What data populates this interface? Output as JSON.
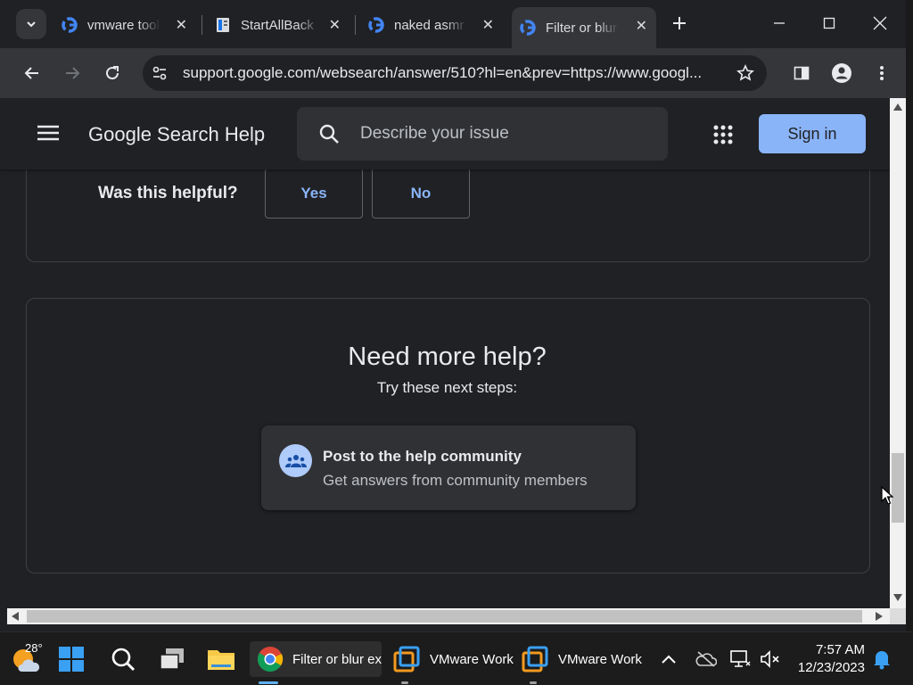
{
  "browser": {
    "tabs": [
      {
        "title": "vmware tool",
        "icon": "google-g-icon",
        "active": false
      },
      {
        "title": "StartAllBack",
        "icon": "startallback-icon",
        "active": false
      },
      {
        "title": "naked asmr",
        "icon": "google-g-icon",
        "active": false
      },
      {
        "title": "Filter or blur",
        "icon": "google-g-icon",
        "active": true
      }
    ],
    "url": "support.google.com/websearch/answer/510?hl=en&prev=https://www.googl..."
  },
  "header": {
    "brand": "Google Search Help",
    "search_placeholder": "Describe your issue",
    "signin_label": "Sign in"
  },
  "feedback": {
    "question": "Was this helpful?",
    "yes_label": "Yes",
    "no_label": "No"
  },
  "more_help": {
    "title": "Need more help?",
    "subtitle": "Try these next steps:",
    "community_title": "Post to the help community",
    "community_desc": "Get answers from community members"
  },
  "taskbar": {
    "weather_temp": "28°",
    "apps": [
      {
        "label": "Filter or blur ex",
        "icon": "chrome-icon"
      },
      {
        "label": "VMware Work",
        "icon": "vmware-icon"
      },
      {
        "label": "VMware Work",
        "icon": "vmware-icon"
      }
    ],
    "time": "7:57 AM",
    "date": "12/23/2023"
  },
  "colors": {
    "accent": "#8ab4f8",
    "background": "#202124",
    "toolbar": "#35363a"
  }
}
